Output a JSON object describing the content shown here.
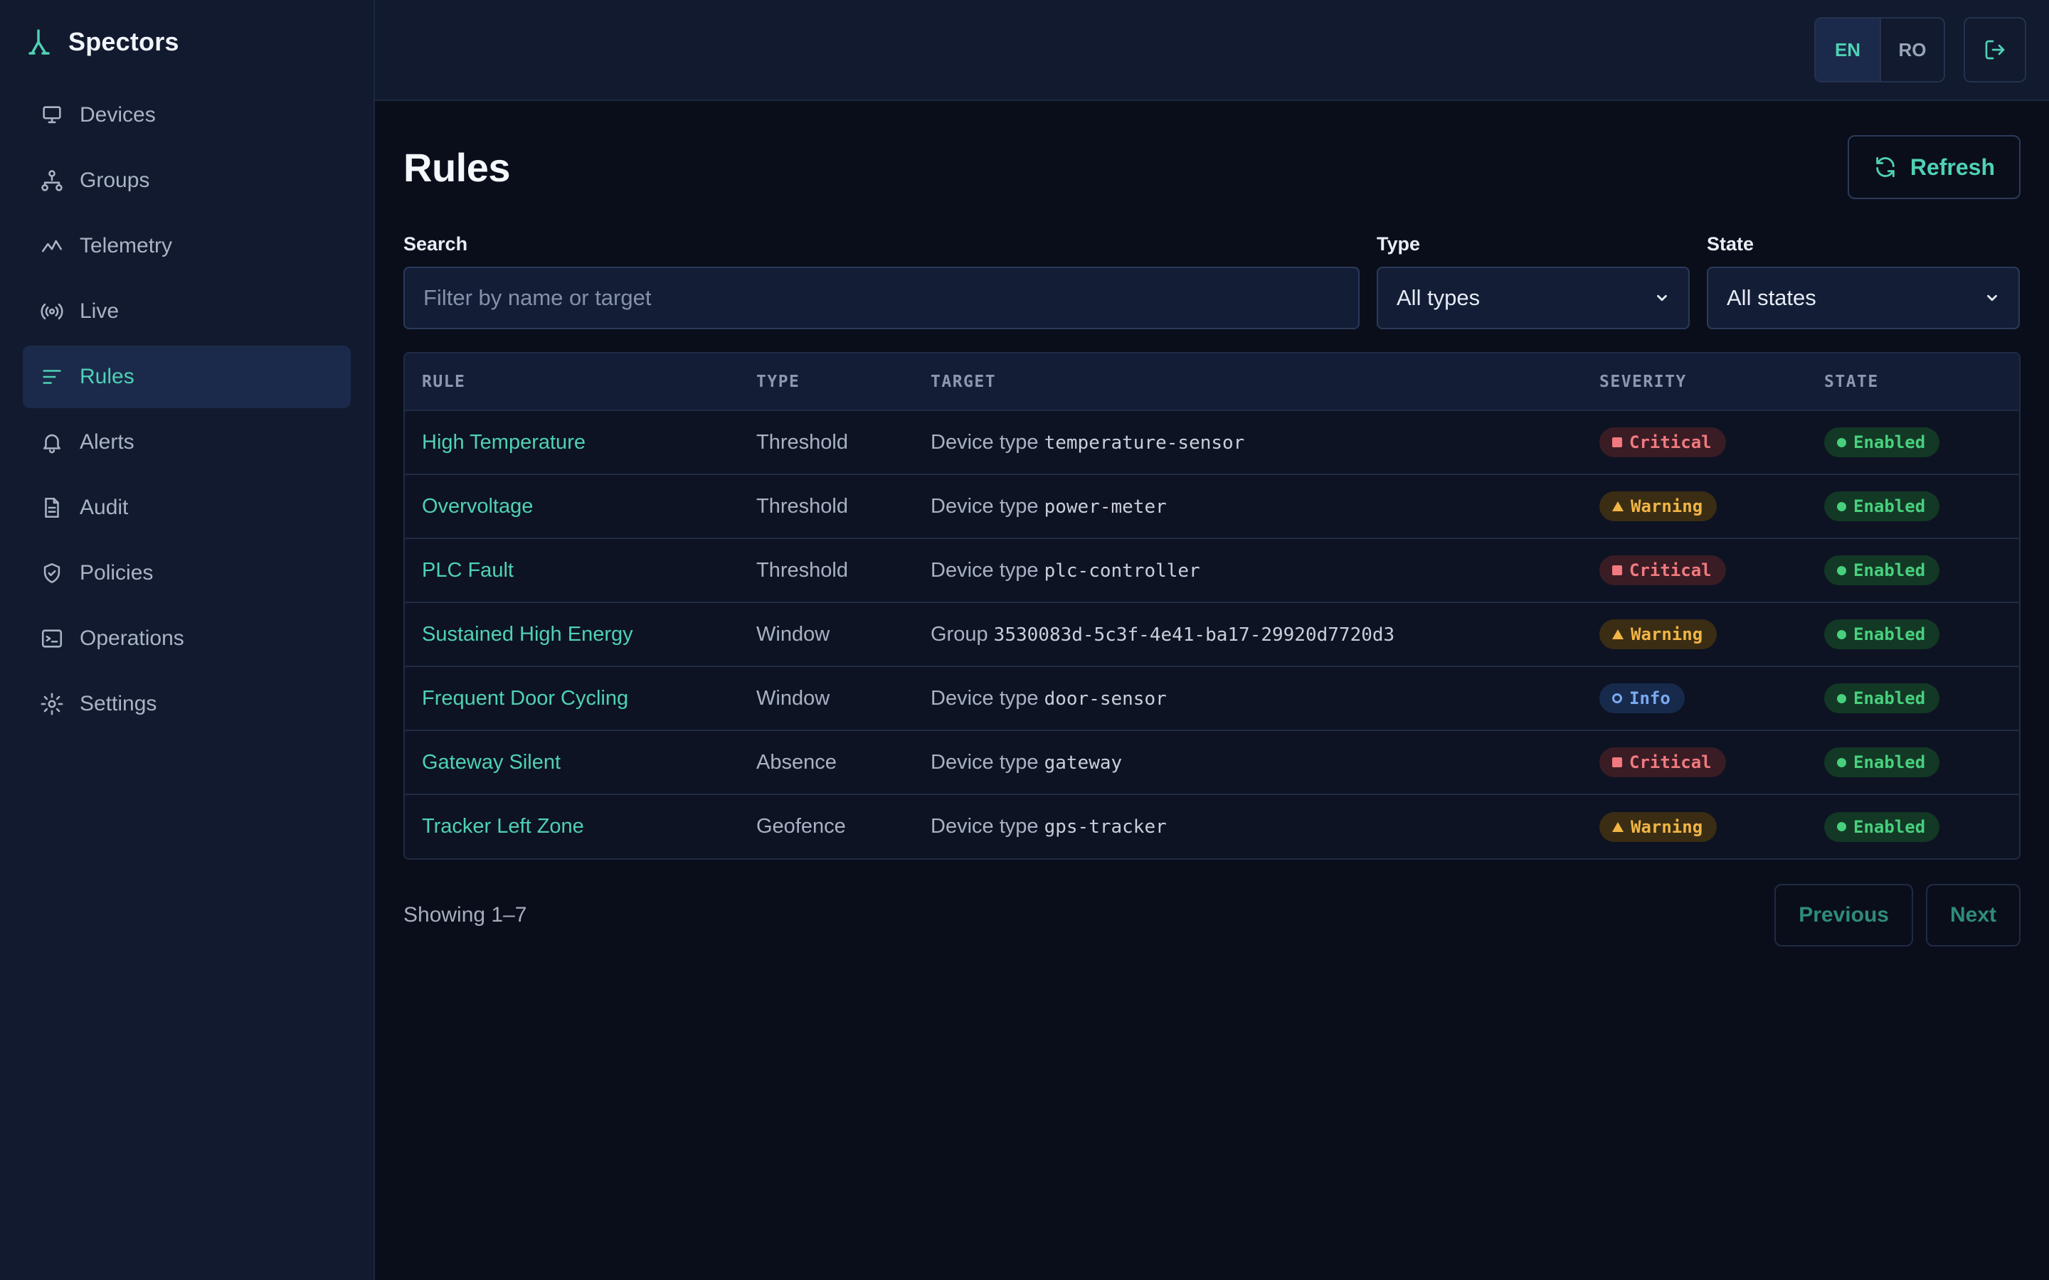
{
  "app": {
    "name": "Spectors"
  },
  "sidebar": {
    "items": [
      {
        "label": "Devices",
        "icon": "monitor-icon"
      },
      {
        "label": "Groups",
        "icon": "groups-icon"
      },
      {
        "label": "Telemetry",
        "icon": "chart-line-icon"
      },
      {
        "label": "Live",
        "icon": "broadcast-icon"
      },
      {
        "label": "Rules",
        "icon": "rules-icon",
        "active": true
      },
      {
        "label": "Alerts",
        "icon": "bell-icon"
      },
      {
        "label": "Audit",
        "icon": "document-icon"
      },
      {
        "label": "Policies",
        "icon": "shield-icon"
      },
      {
        "label": "Operations",
        "icon": "terminal-icon"
      },
      {
        "label": "Settings",
        "icon": "gear-icon"
      }
    ]
  },
  "topbar": {
    "lang_en": "EN",
    "lang_ro": "RO",
    "active_lang": "EN"
  },
  "page": {
    "title": "Rules",
    "refresh_label": "Refresh"
  },
  "filters": {
    "search_label": "Search",
    "search_placeholder": "Filter by name or target",
    "type_label": "Type",
    "type_value": "All types",
    "state_label": "State",
    "state_value": "All states"
  },
  "table": {
    "columns": [
      "RULE",
      "TYPE",
      "TARGET",
      "SEVERITY",
      "STATE"
    ],
    "rows": [
      {
        "rule": "High Temperature",
        "type": "Threshold",
        "target_prefix": "Device type",
        "target_value": "temperature-sensor",
        "severity": "Critical",
        "state": "Enabled"
      },
      {
        "rule": "Overvoltage",
        "type": "Threshold",
        "target_prefix": "Device type",
        "target_value": "power-meter",
        "severity": "Warning",
        "state": "Enabled"
      },
      {
        "rule": "PLC Fault",
        "type": "Threshold",
        "target_prefix": "Device type",
        "target_value": "plc-controller",
        "severity": "Critical",
        "state": "Enabled"
      },
      {
        "rule": "Sustained High Energy",
        "type": "Window",
        "target_prefix": "Group",
        "target_value": "3530083d-5c3f-4e41-ba17-29920d7720d3",
        "severity": "Warning",
        "state": "Enabled"
      },
      {
        "rule": "Frequent Door Cycling",
        "type": "Window",
        "target_prefix": "Device type",
        "target_value": "door-sensor",
        "severity": "Info",
        "state": "Enabled"
      },
      {
        "rule": "Gateway Silent",
        "type": "Absence",
        "target_prefix": "Device type",
        "target_value": "gateway",
        "severity": "Critical",
        "state": "Enabled"
      },
      {
        "rule": "Tracker Left Zone",
        "type": "Geofence",
        "target_prefix": "Device type",
        "target_value": "gps-tracker",
        "severity": "Warning",
        "state": "Enabled"
      }
    ]
  },
  "pagination": {
    "showing": "Showing 1–7",
    "previous": "Previous",
    "next": "Next"
  },
  "colors": {
    "accent": "#4fd1b5",
    "critical": "#f07a7f",
    "warning": "#f2b544",
    "info": "#7aa9f0",
    "enabled": "#48d07e"
  }
}
